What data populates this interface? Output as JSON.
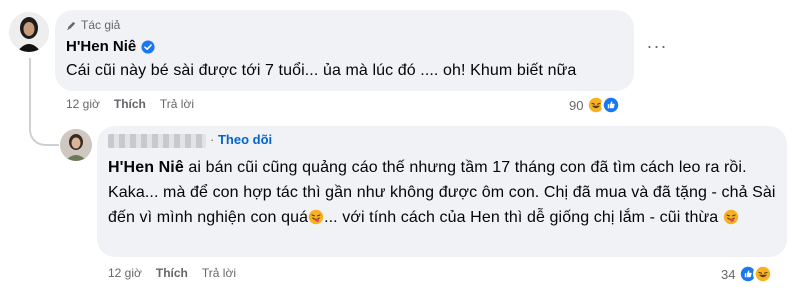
{
  "main_comment": {
    "badge_label": "Tác giả",
    "author": "H'Hen Niê",
    "text": "Cái cũi này bé sài được tới 7 tuổi... ủa mà lúc đó .... oh! Khum biết nữa",
    "time": "12 giờ",
    "like_label": "Thích",
    "reply_label": "Trả lời",
    "reaction_count": "90",
    "reaction_icons": [
      "haha-icon",
      "like-icon"
    ],
    "more_label": "···"
  },
  "reply_comment": {
    "follow_label": "Theo dõi",
    "follow_dot": "·",
    "mention": "H'Hen Niê",
    "text_part1": " ai bán cũi cũng quảng cáo thế nhưng tầm 17 tháng con đã tìm cách leo ra rồi. Kaka... mà để con hợp tác thì gần như không được ôm con. Chị đã mua và đã tặng - chả Sài đến vì mình nghiện con quá",
    "text_part2": "... với tính cách của Hen thì dễ giống chị lắm - cũi thừa ",
    "time": "12 giờ",
    "like_label": "Thích",
    "reply_label": "Trả lời",
    "reaction_count": "34",
    "reaction_icons": [
      "like-icon",
      "haha-icon"
    ]
  },
  "colors": {
    "bubble": "#f0f2f5",
    "link_blue": "#0064d1",
    "like_blue": "#1877f2",
    "haha_yellow": "#f7b125",
    "secondary_text": "#65676b"
  }
}
